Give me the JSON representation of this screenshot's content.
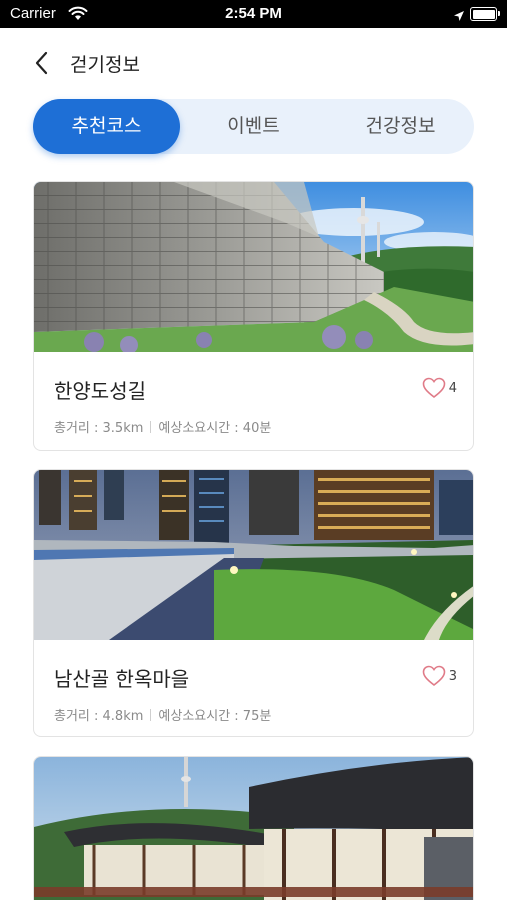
{
  "status_bar": {
    "carrier": "Carrier",
    "time": "2:54 PM"
  },
  "header": {
    "title": "걷기정보"
  },
  "tabs": [
    {
      "label": "추천코스",
      "active": true
    },
    {
      "label": "이벤트",
      "active": false
    },
    {
      "label": "건강정보",
      "active": false
    }
  ],
  "courses": [
    {
      "title": "한양도성길",
      "distance": "총거리 : 3.5km",
      "duration": "예상소요시간 : 40분",
      "likes": "4"
    },
    {
      "title": "남산골 한옥마을",
      "distance": "총거리 : 4.8km",
      "duration": "예상소요시간 : 75분",
      "likes": "3"
    },
    {
      "title": "",
      "distance": "",
      "duration": "",
      "likes": ""
    }
  ],
  "colors": {
    "accent": "#1e6fd6",
    "tab_bg": "#e9f1fb",
    "heart": "#e07b88"
  },
  "icons": [
    "wifi-icon",
    "location-arrow-icon",
    "battery-icon",
    "back-chevron-icon",
    "heart-icon"
  ]
}
